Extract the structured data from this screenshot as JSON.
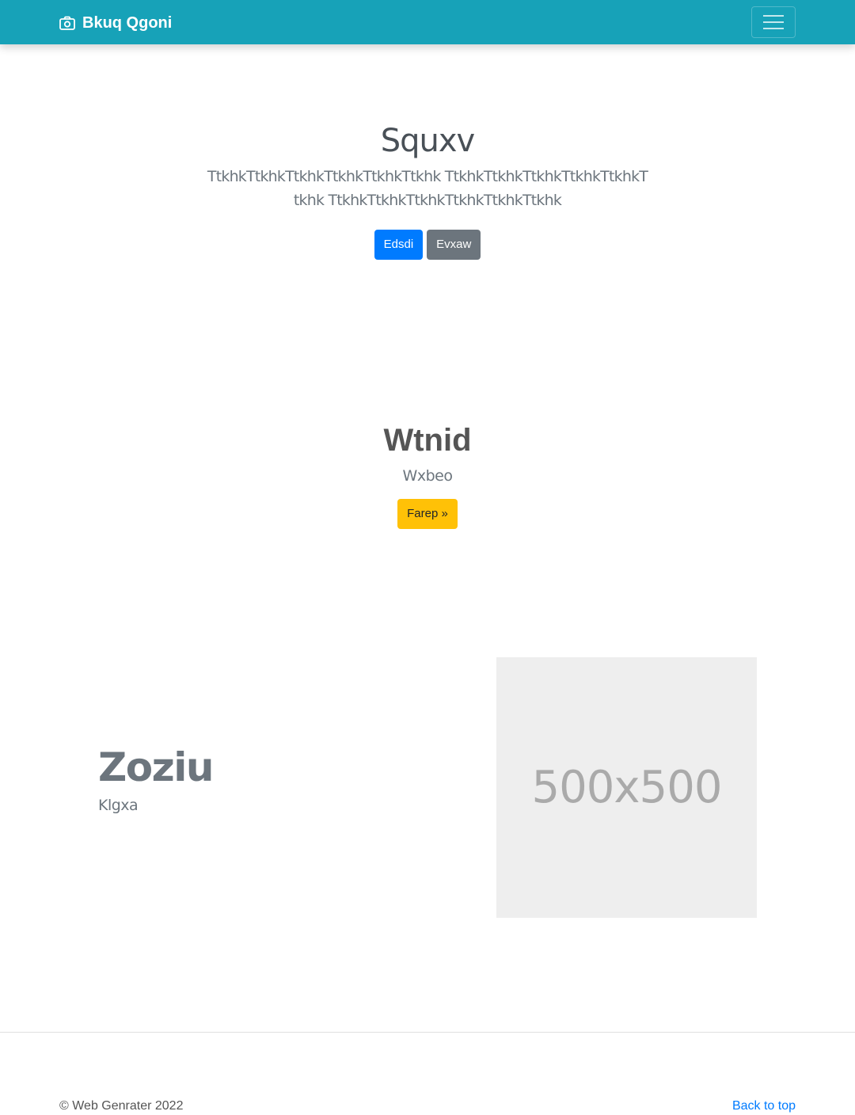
{
  "navbar": {
    "brand": "Bkuq Qgoni",
    "brand_icon": "camera-icon",
    "toggler_icon": "hamburger-icon",
    "background": "#17a2b8"
  },
  "hero": {
    "title": "Squxv",
    "lead": "TtkhkTtkhkTtkhkTtkhkTtkhkTtkhk TtkhkTtkhkTtkhkTtkhkTtkhkTtkhk TtkhkTtkhkTtkhkTtkhkTtkhkTtkhk",
    "primary_button": "Edsdi",
    "secondary_button": "Evxaw"
  },
  "feature": {
    "title": "Wtnid",
    "subtitle": "Wxbeo",
    "button": "Farep »"
  },
  "split": {
    "title": "Zoziu",
    "subtitle": "Klgxa",
    "image_label": "500x500"
  },
  "footer": {
    "copyright": "© Web Genrater 2022",
    "back_to_top": "Back to top"
  },
  "colors": {
    "primary": "#007bff",
    "secondary": "#6c757d",
    "warning": "#ffc107",
    "navbar": "#17a2b8",
    "placeholder_bg": "#eeeeee"
  }
}
